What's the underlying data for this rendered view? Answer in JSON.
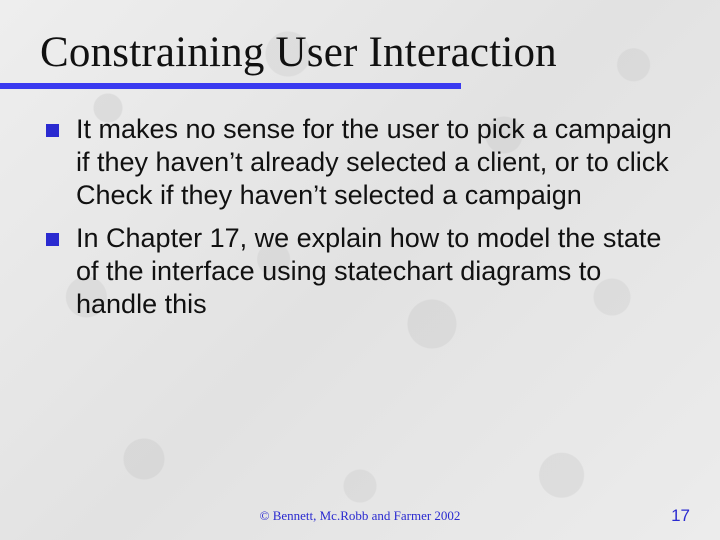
{
  "title": "Constraining User Interaction",
  "bullets": [
    "It makes no sense for the user to pick a campaign if they haven’t already selected a client, or to click Check if they haven’t selected a campaign",
    "In Chapter 17, we explain how to model the state of the interface using statechart diagrams to handle this"
  ],
  "footer": "©  Bennett, Mc.Robb and Farmer 2002",
  "page_number": "17",
  "colors": {
    "accent": "#3a3af0",
    "bullet": "#2a2ad0"
  }
}
